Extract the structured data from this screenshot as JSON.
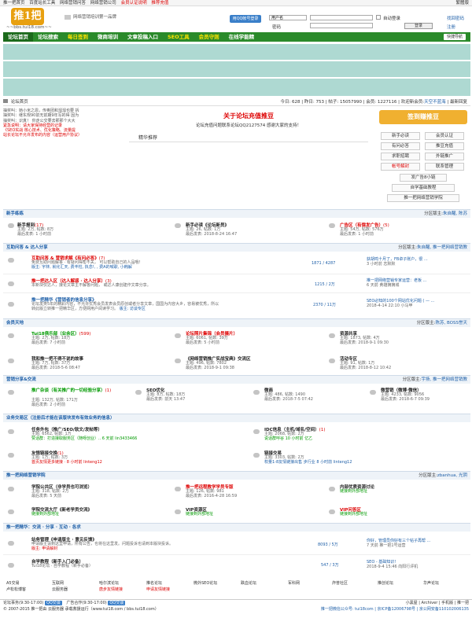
{
  "topbar": {
    "links": [
      "推一把首页",
      "百度站长工具",
      "网络营销问答",
      "网络营销公司"
    ],
    "red_links": [
      "会员认证说明",
      "推荐充值"
    ],
    "right": "繁體版"
  },
  "header": {
    "url": "~~bbs.tui18.com~~",
    "slogan": "网络营销培训第一品牌",
    "qq_login": "用QQ帐号登录"
  },
  "login": {
    "user_select": "用户名",
    "password_label": "密码",
    "auto_login": "自动登录",
    "find_password": "找回密码",
    "login_btn": "登录",
    "register": "注册"
  },
  "nav": {
    "items": [
      "论坛首页",
      "论坛搜索",
      "每日签到",
      "微商培训",
      "文章投稿入口",
      "SEO工具",
      "会员守则",
      "在线学能精"
    ],
    "quick": "快捷导航"
  },
  "crumb": {
    "path": "论坛首页",
    "stats": "今日: 628 | 昨日: 753 | 帖子: 15057990 | 会员: 1227116 | 欢迎新会员:",
    "new_member": "天空不蓝海",
    "newest": "最新回复"
  },
  "left_text": [
    "抽奖叫：她小米之恩，传奥团和溜溜也要 拆",
    "抽奖叫：继东规90前无前期9年写的得 因为",
    "抽奖叫：识真！ 你走公交要去那那个大大",
    "紧急说明：请大家保持经营的记录",
    "《SEO实战 核心技术、优化策略、流量提",
    "站长论坛不允许发布的内容（运营用户协议）"
  ],
  "center": {
    "title": "关于论坛充值推豆",
    "subtitle": "论坛充值问题联系论坛QQ2127574 感谢大家的支持！",
    "tab": "精华推荐"
  },
  "right": {
    "sign": "签到赚推豆",
    "buttons": [
      "新手必读",
      "会员认证",
      "有问必答",
      "推豆充值",
      "求职招聘",
      "外链推广",
      "帐号解封",
      "联系管理"
    ],
    "wide": [
      "发广告8小链",
      "自学基础教程",
      "推一把网络营销学院"
    ]
  },
  "sections": [
    {
      "title": "新手练练",
      "mod": "分区版主:",
      "mods": "朱自醒, 陈苏"
    },
    {
      "title": "互助问答 & 达人分享",
      "mod": "分区版主:",
      "mods": "朱自醒, 推一把网络营销教"
    },
    {
      "title": "会员天地",
      "mod": "分区版主:",
      "mods": "陈苏, BOSS誉天"
    },
    {
      "title": "营销分享&交流",
      "mod": "分区版主:",
      "mods": "宇扬, 推一把网络营销教"
    },
    {
      "title": "业务交易区（注册后才能在该版块发布有效业务的信息）",
      "mod": "",
      "mods": ""
    },
    {
      "title": "推一把网络营销学院",
      "mod": "分区版主:",
      "mods": "zbanhua, 光阴"
    },
    {
      "title": "推一把精华：交流 · 分享 · 互动 · 各求",
      "mod": "",
      "mods": ""
    }
  ],
  "forums": {
    "s1": [
      {
        "name": "新手报到",
        "count": "(17)",
        "s1": "主题: 2万, 帖数: 8万",
        "s2": "最后发表: 1 小时前"
      },
      {
        "name": "新手必读《论坛新员》",
        "count": "",
        "s1": "主题: 26, 帖数: 1万",
        "s2": "最后发表: 2018-8-24 16:47"
      },
      {
        "name": "广告区（有偿发广告）",
        "count": "(5)",
        "s1": "主题: 54万, 帖数: 576万",
        "s2": "最后发表: 1 小时前"
      }
    ],
    "s2": [
      {
        "name": "互助问答 & 营销求解《有问必答》",
        "count": "(7)",
        "desc": "免费互助问题解答 · 有疑问得帮不关， 可以帮助自己的人品哦!",
        "mod": "版主: 宇林, 就化汇天, 费丰柱, 执念!, , 费A的喊歌, 小韩解",
        "stat": "1871 / 4287",
        "last1": "获胡鸣十月了，FB卓子账户，很 ...",
        "last2": "3 小时前 志默默"
      },
      {
        "name": "推一把达人区（达人解惑 · 达人分享）",
        "count": "(3)",
        "desc": "本新块仅达人，接论文章主不解答问题， 或达人康创建作文章分享。",
        "mod": "",
        "stat": "1215 / 2万",
        "last1": "推一把网络营销专家运营：老板 ...",
        "last2": "6 天前 黄雄摘摘城"
      },
      {
        "name": "推一把精华《营销者的信息分享》",
        "count": "",
        "desc": "论坛发类5年的精彩内容，不允许优秀会员发表会员原创或者分享文章，国国为内容大乡，容易被优秀，所以转此版立转推一把精华区，方便网用户阅读学习。",
        "mod": "版主: 访谈专区",
        "stat": "2370 / 11万",
        "last1": "SEO必知的100个网站优化问题 ( — ...",
        "last2": "2018-4-14 22:10 小马甲"
      }
    ],
    "s3": [
      {
        "name": "Tui18俱乐部（业余区）",
        "count": "(599)",
        "s1": "主题: 2万, 帖数: 18万",
        "s2": "最后发表: 7 小时前"
      },
      {
        "name": "论坛照片集锦（会员摄片）",
        "count": "",
        "s1": "主题: 6061, 帖数: 39万",
        "s2": "最后发表: 5 小时前"
      },
      {
        "name": "资源共享",
        "count": "",
        "s1": "主题: 1873, 帖数: 4万",
        "s2": "最后发表: 2018-9-1 09:30"
      },
      {
        "name": "我和推一把不得不说的故事",
        "count": "",
        "s1": "主题: 7万, 帖数: 37万",
        "s2": "最后发表: 2018-5-6 08:47"
      },
      {
        "name": "《网络营销推广实战宝典》交流区",
        "count": "",
        "s1": "主题: 496, 帖数: 7802",
        "s2": "最后发表: 2018-9-1 09:38"
      },
      {
        "name": "活动专区",
        "count": "",
        "s1": "主题: 91, 帖数: 1万",
        "s2": "最后发表: 2018-8-12 10:42"
      }
    ],
    "s4": [
      {
        "name": "推广杂谈（有关推广的一切经验分享）",
        "count": "(1)",
        "s1": "主题: 132万, 帖数: 171万",
        "s2": "最后发表: 2 小时前"
      },
      {
        "name": "SEO优化",
        "count": "",
        "s1": "主题: 8万, 帖数: 18万",
        "s2": "最后发表: 前天 13:47"
      },
      {
        "name": "微商",
        "count": "",
        "s1": "主题: 486, 帖数: 1490",
        "s2": "最后发表: 2018-7-5 07:42"
      },
      {
        "name": "微营销（微博·微信）",
        "count": "",
        "s1": "主题: 4233, 帖数: 9056",
        "s2": "最后发表: 2018-6-7 09:39"
      }
    ],
    "s5": [
      {
        "name": "任务外包（推广/SEO/软文/发帖等）",
        "count": "",
        "s1": "主题: 6562, 帖数: 1万",
        "s2": "赞话群：打造接取服务区（随呀创业）.. 6 天前 lin3433466"
      },
      {
        "name": "IDC信息（主机/域名/空间）",
        "count": "(1)",
        "s1": "主题: 2068, 帖数: 2万",
        "s2": "说话群呼谷 10 小时前 亿乙"
      },
      {
        "name": "友情链接交换",
        "count": "(1)",
        "s1": "主题: 1万, 帖数: 3万",
        "s2": "首页友情更多链接 · 8 小时前 linteng12"
      },
      {
        "name": "链接交易",
        "count": "",
        "s1": "主题: 3303, 帖数: 2万",
        "s2": "权量1-8友情链接出售 步行业 8 小时前 linteng12"
      }
    ],
    "s6": [
      {
        "name": "学院公共区（非学员也可浏览）",
        "count": "",
        "s1": "主题: 318, 帖数: 2万",
        "s2": "最后发表: 5 天前"
      },
      {
        "name": "推一把远程教学学员专版",
        "count": "",
        "s1": "主题: 126, 帖数: 981",
        "s2": "最后发表: 2016-4-28 16:59"
      },
      {
        "name": "内部优质资源讨论",
        "count": "",
        "s1": "链接到外部地址",
        "s2": ""
      },
      {
        "name": "学院交流大厅《新老学员交流》",
        "count": "",
        "s1": "链接到外部地址",
        "s2": ""
      },
      {
        "name": "VIP资源区",
        "count": "",
        "s1": "链接到外部地址",
        "s2": ""
      },
      {
        "name": "VIP问答区",
        "count": "",
        "s1": "链接到外部地址",
        "s2": ""
      }
    ],
    "s7": [
      {
        "name": "站务管理《申请版主 · 意见反馈》",
        "count": "",
        "desc": "申请版主请到这里申请，所有公告，也将在这里发。问题投诉也请到本版块投诉。",
        "mod": "版主: 申请解封",
        "stat": "8093 / 5万",
        "last1": "你好，管理员你好有三个帖子再帮 ...",
        "last2": "7 天前 推一把1号运营"
      },
      {
        "name": "自学教程（新手入门必备）",
        "count": "",
        "desc": "Tui18论坛 · 自学教程（新手必备）",
        "mod": "",
        "stat": "547 / 3万",
        "last1": "SEO - 基础知识!",
        "last2": "2018-9-4 15:46 向阳行评机"
      }
    ]
  },
  "links_row": [
    [
      "A5交易",
      "互联网",
      "哈尔滨论坛",
      "推名论坛",
      "微外SEO论坛",
      "跌血论坛",
      "军科网",
      "炸普社区",
      "推创论坛",
      "华声论坛"
    ],
    [
      "卢松松博客",
      "云服务器",
      "唐步友情链接",
      "申请友情链接"
    ]
  ],
  "footer": {
    "l1": "论坛事务(9:30-17:00)",
    "qq": "QQ交谈",
    "l1b": "广告合作(9:30-17:00)",
    "l1r": "小黑屋 | Archiver | 手机版 | 推一把",
    "l2": "© 2007-2015 推一把由 云服务器 承载救援运行（www.tui18.com / bbs.tui18.com）",
    "l2r": "推一把微信公众号: tui18com | 京ICP备12006798号 | 京公网安备110102006135"
  }
}
